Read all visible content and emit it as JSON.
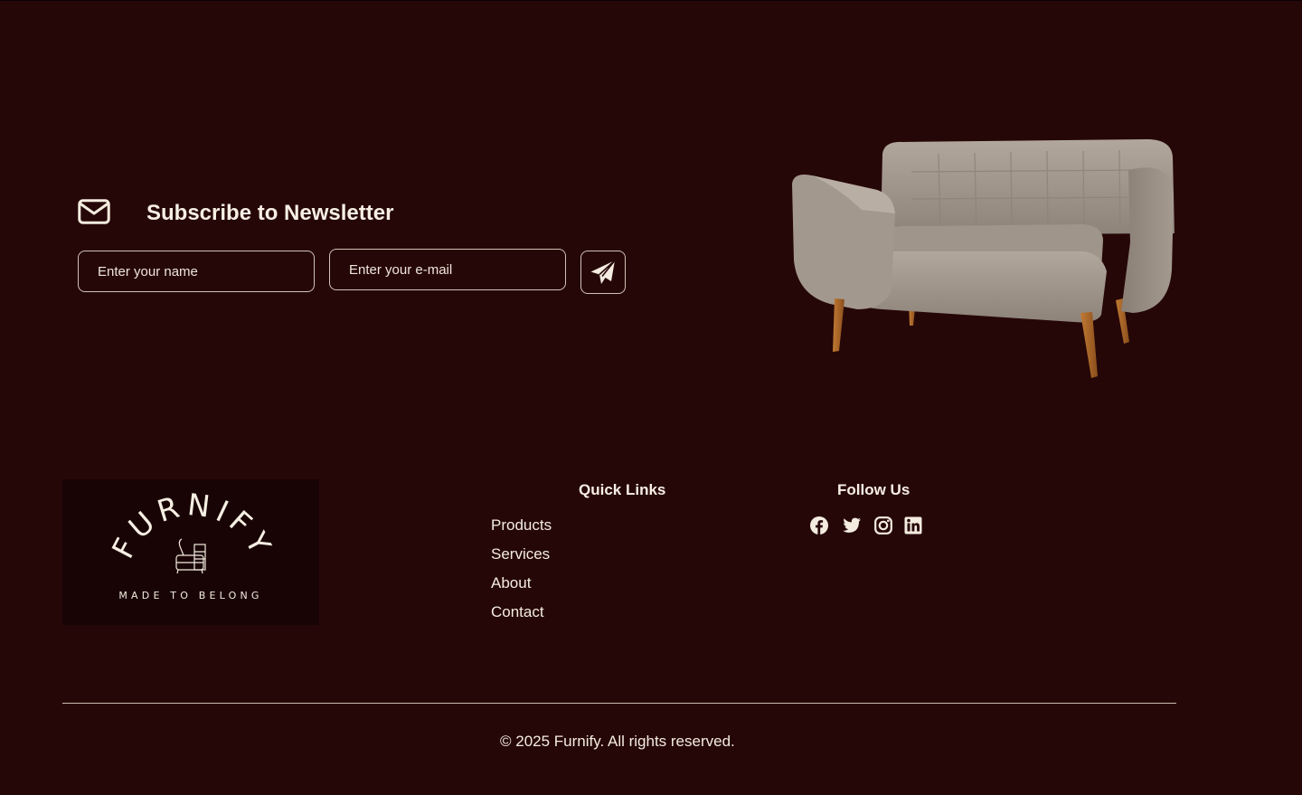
{
  "newsletter": {
    "icon": "envelope-icon",
    "title": "Subscribe to Newsletter",
    "name_placeholder": "Enter your name",
    "email_placeholder": "Enter your e-mail",
    "submit_icon": "paper-plane-icon"
  },
  "hero_image": {
    "subject": "sofa"
  },
  "footer": {
    "logo": {
      "brand": "FURNIFY",
      "tagline": "MADE TO BELONG"
    },
    "quick_links": {
      "title": "Quick Links",
      "items": [
        {
          "label": "Products"
        },
        {
          "label": "Services"
        },
        {
          "label": "About"
        },
        {
          "label": "Contact"
        }
      ]
    },
    "follow_us": {
      "title": "Follow Us",
      "icons": [
        "facebook-icon",
        "twitter-icon",
        "instagram-icon",
        "linkedin-icon"
      ]
    },
    "copyright": "© 2025 Furnify. All rights reserved."
  },
  "colors": {
    "background": "#260708",
    "text": "#f4ecdf",
    "logo_background": "#190405",
    "border": "#cfc3b6"
  }
}
